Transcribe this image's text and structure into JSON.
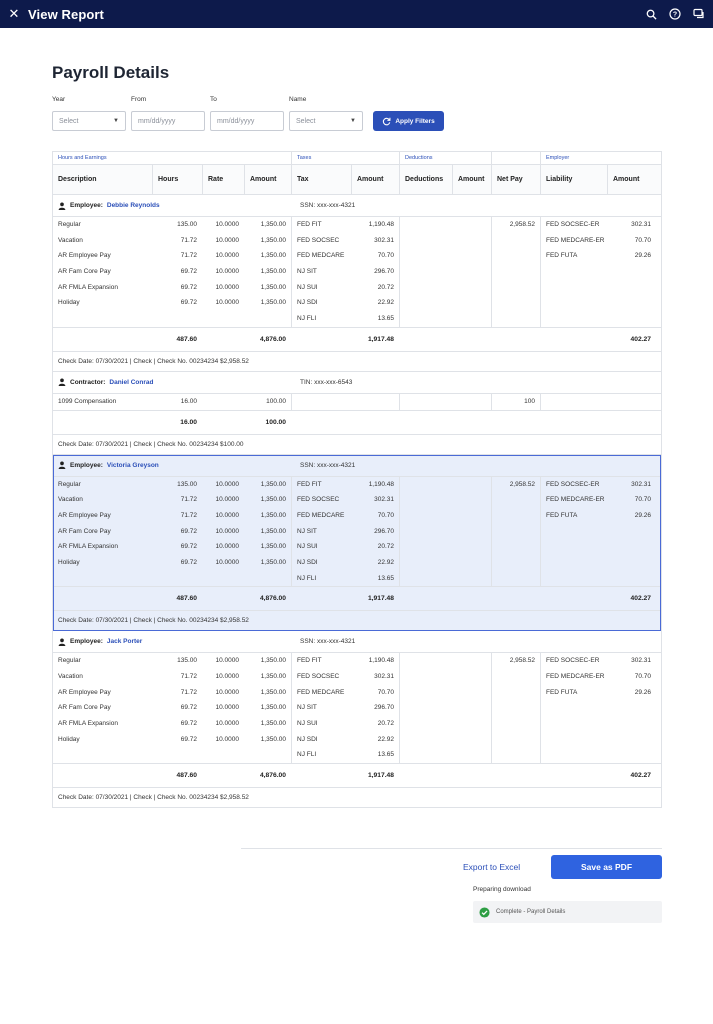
{
  "header": {
    "title": "View Report",
    "close_icon": "close-icon",
    "icons": [
      "search-icon",
      "help-icon",
      "chat-icon"
    ]
  },
  "page": {
    "title": "Payroll Details"
  },
  "filters": {
    "year_label": "Year",
    "year_value": "Select",
    "from_label": "From",
    "from_placeholder": "mm/dd/yyyy",
    "to_label": "To",
    "to_placeholder": "mm/dd/yyyy",
    "name_label": "Name",
    "name_value": "Select",
    "apply_label": "Apply Filters"
  },
  "table": {
    "groups": {
      "hours": "Hours and Earnings",
      "taxes": "Taxes",
      "deductions": "Deductions",
      "employer": "Employer"
    },
    "columns": [
      "Description",
      "Hours",
      "Rate",
      "Amount",
      "Tax",
      "Amount",
      "Deductions",
      "Amount",
      "Net Pay",
      "Liability",
      "Amount"
    ],
    "blocks": [
      {
        "type_label": "Employee:",
        "name": "Debbie Reynolds",
        "id": "SSN: xxx-xxx-4321",
        "selected": false,
        "earnings": [
          {
            "d": "Regular",
            "h": "135.00",
            "r": "10.0000",
            "a": "1,350.00"
          },
          {
            "d": "Vacation",
            "h": "71.72",
            "r": "10.0000",
            "a": "1,350.00"
          },
          {
            "d": "AR Employee Pay",
            "h": "71.72",
            "r": "10.0000",
            "a": "1,350.00"
          },
          {
            "d": "AR Fam Core Pay",
            "h": "69.72",
            "r": "10.0000",
            "a": "1,350.00"
          },
          {
            "d": "AR FMLA Expansion",
            "h": "69.72",
            "r": "10.0000",
            "a": "1,350.00"
          },
          {
            "d": "Holiday",
            "h": "69.72",
            "r": "10.0000",
            "a": "1,350.00"
          }
        ],
        "taxes": [
          {
            "t": "FED FIT",
            "a": "1,190.48"
          },
          {
            "t": "FED SOCSEC",
            "a": "302.31"
          },
          {
            "t": "FED MEDCARE",
            "a": "70.70"
          },
          {
            "t": "NJ SIT",
            "a": "296.70"
          },
          {
            "t": "NJ SUI",
            "a": "20.72"
          },
          {
            "t": "NJ SDI",
            "a": "22.92"
          },
          {
            "t": "NJ FLI",
            "a": "13.65"
          }
        ],
        "net_pay": "2,958.52",
        "liabilities": [
          {
            "l": "FED SOCSEC-ER",
            "a": "302.31"
          },
          {
            "l": "FED MEDCARE-ER",
            "a": "70.70"
          },
          {
            "l": "FED FUTA",
            "a": "29.26"
          }
        ],
        "totals": {
          "hours": "487.60",
          "amount": "4,876.00",
          "taxes": "1,917.48",
          "employer": "402.27"
        },
        "check": "Check Date: 07/30/2021  |  Check  |  Check No. 00234234 $2,958.52"
      },
      {
        "type_label": "Contractor:",
        "name": "Daniel Conrad",
        "id": "TIN: xxx-xxx-6543",
        "selected": false,
        "earnings": [
          {
            "d": "1099 Compensation",
            "h": "16.00",
            "r": "",
            "a": "100.00"
          }
        ],
        "taxes": [],
        "net_pay": "100",
        "liabilities": [],
        "totals": {
          "hours": "16.00",
          "amount": "100.00",
          "taxes": "",
          "employer": ""
        },
        "check": "Check Date: 07/30/2021  |  Check  |  Check No. 00234234 $100.00"
      },
      {
        "type_label": "Employee:",
        "name": "Victoria Greyson",
        "id": "SSN: xxx-xxx-4321",
        "selected": true,
        "earnings": [
          {
            "d": "Regular",
            "h": "135.00",
            "r": "10.0000",
            "a": "1,350.00"
          },
          {
            "d": "Vacation",
            "h": "71.72",
            "r": "10.0000",
            "a": "1,350.00"
          },
          {
            "d": "AR Employee Pay",
            "h": "71.72",
            "r": "10.0000",
            "a": "1,350.00"
          },
          {
            "d": "AR Fam Core Pay",
            "h": "69.72",
            "r": "10.0000",
            "a": "1,350.00"
          },
          {
            "d": "AR FMLA Expansion",
            "h": "69.72",
            "r": "10.0000",
            "a": "1,350.00"
          },
          {
            "d": "Holiday",
            "h": "69.72",
            "r": "10.0000",
            "a": "1,350.00"
          }
        ],
        "taxes": [
          {
            "t": "FED FIT",
            "a": "1,190.48"
          },
          {
            "t": "FED SOCSEC",
            "a": "302.31"
          },
          {
            "t": "FED MEDCARE",
            "a": "70.70"
          },
          {
            "t": "NJ SIT",
            "a": "296.70"
          },
          {
            "t": "NJ SUI",
            "a": "20.72"
          },
          {
            "t": "NJ SDI",
            "a": "22.92"
          },
          {
            "t": "NJ FLI",
            "a": "13.65"
          }
        ],
        "net_pay": "2,958.52",
        "liabilities": [
          {
            "l": "FED SOCSEC-ER",
            "a": "302.31"
          },
          {
            "l": "FED MEDCARE-ER",
            "a": "70.70"
          },
          {
            "l": "FED FUTA",
            "a": "29.26"
          }
        ],
        "totals": {
          "hours": "487.60",
          "amount": "4,876.00",
          "taxes": "1,917.48",
          "employer": "402.27"
        },
        "check": "Check Date: 07/30/2021  |  Check  |  Check No. 00234234 $2,958.52"
      },
      {
        "type_label": "Employee:",
        "name": "Jack Porter",
        "id": "SSN: xxx-xxx-4321",
        "selected": false,
        "earnings": [
          {
            "d": "Regular",
            "h": "135.00",
            "r": "10.0000",
            "a": "1,350.00"
          },
          {
            "d": "Vacation",
            "h": "71.72",
            "r": "10.0000",
            "a": "1,350.00"
          },
          {
            "d": "AR Employee Pay",
            "h": "71.72",
            "r": "10.0000",
            "a": "1,350.00"
          },
          {
            "d": "AR Fam Core Pay",
            "h": "69.72",
            "r": "10.0000",
            "a": "1,350.00"
          },
          {
            "d": "AR FMLA Expansion",
            "h": "69.72",
            "r": "10.0000",
            "a": "1,350.00"
          },
          {
            "d": "Holiday",
            "h": "69.72",
            "r": "10.0000",
            "a": "1,350.00"
          }
        ],
        "taxes": [
          {
            "t": "FED FIT",
            "a": "1,190.48"
          },
          {
            "t": "FED SOCSEC",
            "a": "302.31"
          },
          {
            "t": "FED MEDCARE",
            "a": "70.70"
          },
          {
            "t": "NJ SIT",
            "a": "296.70"
          },
          {
            "t": "NJ SUI",
            "a": "20.72"
          },
          {
            "t": "NJ SDI",
            "a": "22.92"
          },
          {
            "t": "NJ FLI",
            "a": "13.65"
          }
        ],
        "net_pay": "2,958.52",
        "liabilities": [
          {
            "l": "FED SOCSEC-ER",
            "a": "302.31"
          },
          {
            "l": "FED MEDCARE-ER",
            "a": "70.70"
          },
          {
            "l": "FED FUTA",
            "a": "29.26"
          }
        ],
        "totals": {
          "hours": "487.60",
          "amount": "4,876.00",
          "taxes": "1,917.48",
          "employer": "402.27"
        },
        "check": "Check Date: 07/30/2021  |  Check  |  Check No. 00234234 $2,958.52"
      }
    ]
  },
  "footer": {
    "export_label": "Export to Excel",
    "pdf_label": "Save as PDF",
    "preparing": "Preparing download",
    "complete": "Complete - Payroll Details"
  },
  "colors": {
    "header_bg": "#0d1a4b",
    "accent": "#2b4fb8",
    "primary_button": "#2f63e0",
    "selected_row_bg": "#e8eefa",
    "success": "#2e9e44"
  }
}
